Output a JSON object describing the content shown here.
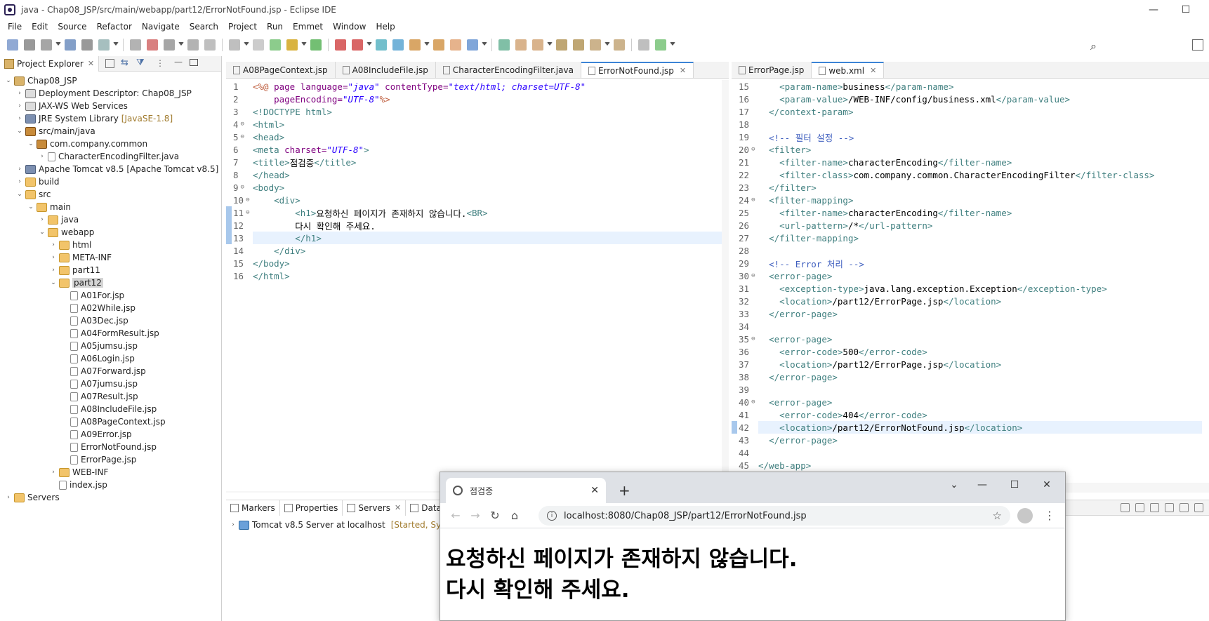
{
  "window": {
    "title": "java - Chap08_JSP/src/main/webapp/part12/ErrorNotFound.jsp - Eclipse IDE"
  },
  "menu": [
    "File",
    "Edit",
    "Source",
    "Refactor",
    "Navigate",
    "Search",
    "Project",
    "Run",
    "Emmet",
    "Window",
    "Help"
  ],
  "explorer": {
    "tab_label": "Project Explorer",
    "tree": [
      {
        "label": "Chap08_JSP",
        "depth": 0,
        "twisty": "open",
        "icon": "project"
      },
      {
        "label": "Deployment Descriptor: Chap08_JSP",
        "depth": 1,
        "twisty": "closed",
        "icon": "desc"
      },
      {
        "label": "JAX-WS Web Services",
        "depth": 1,
        "twisty": "closed",
        "icon": "desc"
      },
      {
        "label": "JRE System Library",
        "depth": 1,
        "twisty": "closed",
        "icon": "jar",
        "deco": "[JavaSE-1.8]"
      },
      {
        "label": "src/main/java",
        "depth": 1,
        "twisty": "open",
        "icon": "package"
      },
      {
        "label": "com.company.common",
        "depth": 2,
        "twisty": "open",
        "icon": "package"
      },
      {
        "label": "CharacterEncodingFilter.java",
        "depth": 3,
        "twisty": "closed",
        "icon": "file"
      },
      {
        "label": "Apache Tomcat v8.5 [Apache Tomcat v8.5]",
        "depth": 1,
        "twisty": "closed",
        "icon": "jar"
      },
      {
        "label": "build",
        "depth": 1,
        "twisty": "closed",
        "icon": "folder"
      },
      {
        "label": "src",
        "depth": 1,
        "twisty": "open",
        "icon": "folder"
      },
      {
        "label": "main",
        "depth": 2,
        "twisty": "open",
        "icon": "folder"
      },
      {
        "label": "java",
        "depth": 3,
        "twisty": "closed",
        "icon": "folder"
      },
      {
        "label": "webapp",
        "depth": 3,
        "twisty": "open",
        "icon": "folder"
      },
      {
        "label": "html",
        "depth": 4,
        "twisty": "closed",
        "icon": "folder"
      },
      {
        "label": "META-INF",
        "depth": 4,
        "twisty": "closed",
        "icon": "folder"
      },
      {
        "label": "part11",
        "depth": 4,
        "twisty": "closed",
        "icon": "folder"
      },
      {
        "label": "part12",
        "depth": 4,
        "twisty": "open",
        "icon": "folder",
        "selected": true
      },
      {
        "label": "A01For.jsp",
        "depth": 5,
        "twisty": "none",
        "icon": "file"
      },
      {
        "label": "A02While.jsp",
        "depth": 5,
        "twisty": "none",
        "icon": "file"
      },
      {
        "label": "A03Dec.jsp",
        "depth": 5,
        "twisty": "none",
        "icon": "file"
      },
      {
        "label": "A04FormResult.jsp",
        "depth": 5,
        "twisty": "none",
        "icon": "file"
      },
      {
        "label": "A05jumsu.jsp",
        "depth": 5,
        "twisty": "none",
        "icon": "file"
      },
      {
        "label": "A06Login.jsp",
        "depth": 5,
        "twisty": "none",
        "icon": "file"
      },
      {
        "label": "A07Forward.jsp",
        "depth": 5,
        "twisty": "none",
        "icon": "file"
      },
      {
        "label": "A07jumsu.jsp",
        "depth": 5,
        "twisty": "none",
        "icon": "file"
      },
      {
        "label": "A07Result.jsp",
        "depth": 5,
        "twisty": "none",
        "icon": "file"
      },
      {
        "label": "A08IncludeFile.jsp",
        "depth": 5,
        "twisty": "none",
        "icon": "file"
      },
      {
        "label": "A08PageContext.jsp",
        "depth": 5,
        "twisty": "none",
        "icon": "file"
      },
      {
        "label": "A09Error.jsp",
        "depth": 5,
        "twisty": "none",
        "icon": "file"
      },
      {
        "label": "ErrorNotFound.jsp",
        "depth": 5,
        "twisty": "none",
        "icon": "file"
      },
      {
        "label": "ErrorPage.jsp",
        "depth": 5,
        "twisty": "none",
        "icon": "file"
      },
      {
        "label": "WEB-INF",
        "depth": 4,
        "twisty": "closed",
        "icon": "folder"
      },
      {
        "label": "index.jsp",
        "depth": 4,
        "twisty": "none",
        "icon": "file"
      },
      {
        "label": "Servers",
        "depth": 0,
        "twisty": "closed",
        "icon": "folder"
      }
    ]
  },
  "editor_left": {
    "tabs": [
      {
        "label": "A08PageContext.jsp",
        "active": false
      },
      {
        "label": "A08IncludeFile.jsp",
        "active": false
      },
      {
        "label": "CharacterEncodingFilter.java",
        "active": false
      },
      {
        "label": "ErrorNotFound.jsp",
        "active": true
      }
    ],
    "lines": [
      {
        "n": "1",
        "fold": "",
        "mark": false,
        "hl": false,
        "parts": [
          [
            "jsp",
            "<%@ "
          ],
          [
            "attr",
            "page "
          ],
          [
            "attr",
            "language="
          ],
          [
            "val",
            "\"java\" "
          ],
          [
            "attr",
            "contentType="
          ],
          [
            "val",
            "\"text/html; charset=UTF-8\""
          ]
        ]
      },
      {
        "n": "2",
        "fold": "",
        "mark": false,
        "hl": false,
        "parts": [
          [
            "txt",
            "    "
          ],
          [
            "attr",
            "pageEncoding="
          ],
          [
            "val",
            "\"UTF-8\""
          ],
          [
            "jsp",
            "%>"
          ]
        ]
      },
      {
        "n": "3",
        "fold": "",
        "mark": false,
        "hl": false,
        "parts": [
          [
            "tag",
            "<!DOCTYPE html>"
          ]
        ]
      },
      {
        "n": "4",
        "fold": "⊖",
        "mark": false,
        "hl": false,
        "parts": [
          [
            "tag",
            "<html>"
          ]
        ]
      },
      {
        "n": "5",
        "fold": "⊖",
        "mark": false,
        "hl": false,
        "parts": [
          [
            "tag",
            "<head>"
          ]
        ]
      },
      {
        "n": "6",
        "fold": "",
        "mark": false,
        "hl": false,
        "parts": [
          [
            "tag",
            "<meta "
          ],
          [
            "attr",
            "charset="
          ],
          [
            "val",
            "\"UTF-8\""
          ],
          [
            "tag",
            ">"
          ]
        ]
      },
      {
        "n": "7",
        "fold": "",
        "mark": false,
        "hl": false,
        "parts": [
          [
            "tag",
            "<title>"
          ],
          [
            "txt",
            "점검중"
          ],
          [
            "tag",
            "</title>"
          ]
        ]
      },
      {
        "n": "8",
        "fold": "",
        "mark": false,
        "hl": false,
        "parts": [
          [
            "tag",
            "</head>"
          ]
        ]
      },
      {
        "n": "9",
        "fold": "⊖",
        "mark": false,
        "hl": false,
        "parts": [
          [
            "tag",
            "<body>"
          ]
        ]
      },
      {
        "n": "10",
        "fold": "⊖",
        "mark": false,
        "hl": false,
        "parts": [
          [
            "txt",
            "    "
          ],
          [
            "tag",
            "<div>"
          ]
        ]
      },
      {
        "n": "11",
        "fold": "⊖",
        "mark": true,
        "hl": false,
        "parts": [
          [
            "txt",
            "        "
          ],
          [
            "tag",
            "<h1>"
          ],
          [
            "txt",
            "요청하신 페이지가 존재하지 않습니다."
          ],
          [
            "tag",
            "<BR>"
          ]
        ]
      },
      {
        "n": "12",
        "fold": "",
        "mark": true,
        "hl": false,
        "parts": [
          [
            "txt",
            "        다시 확인해 주세요."
          ]
        ]
      },
      {
        "n": "13",
        "fold": "",
        "mark": true,
        "hl": true,
        "parts": [
          [
            "txt",
            "        "
          ],
          [
            "tag",
            "</h1>"
          ]
        ]
      },
      {
        "n": "14",
        "fold": "",
        "mark": false,
        "hl": false,
        "parts": [
          [
            "txt",
            "    "
          ],
          [
            "tag",
            "</div>"
          ]
        ]
      },
      {
        "n": "15",
        "fold": "",
        "mark": false,
        "hl": false,
        "parts": [
          [
            "tag",
            "</body>"
          ]
        ]
      },
      {
        "n": "16",
        "fold": "",
        "mark": false,
        "hl": false,
        "parts": [
          [
            "tag",
            "</html>"
          ]
        ]
      }
    ]
  },
  "editor_right": {
    "tabs": [
      {
        "label": "ErrorPage.jsp",
        "active": false
      },
      {
        "label": "web.xml",
        "active": true
      }
    ],
    "lines": [
      {
        "n": "15",
        "fold": "",
        "mark": false,
        "hl": false,
        "parts": [
          [
            "txt",
            "    "
          ],
          [
            "tag",
            "<param-name>"
          ],
          [
            "txt",
            "business"
          ],
          [
            "tag",
            "</param-name>"
          ]
        ]
      },
      {
        "n": "16",
        "fold": "",
        "mark": false,
        "hl": false,
        "parts": [
          [
            "txt",
            "    "
          ],
          [
            "tag",
            "<param-value>"
          ],
          [
            "txt",
            "/WEB-INF/config/business.xml"
          ],
          [
            "tag",
            "</param-value>"
          ]
        ]
      },
      {
        "n": "17",
        "fold": "",
        "mark": false,
        "hl": false,
        "parts": [
          [
            "txt",
            "  "
          ],
          [
            "tag",
            "</context-param>"
          ]
        ]
      },
      {
        "n": "18",
        "fold": "",
        "mark": false,
        "hl": false,
        "parts": []
      },
      {
        "n": "19",
        "fold": "",
        "mark": false,
        "hl": false,
        "parts": [
          [
            "txt",
            "  "
          ],
          [
            "com",
            "<!-- 필터 설정 -->"
          ]
        ]
      },
      {
        "n": "20",
        "fold": "⊖",
        "mark": false,
        "hl": false,
        "parts": [
          [
            "txt",
            "  "
          ],
          [
            "tag",
            "<filter>"
          ]
        ]
      },
      {
        "n": "21",
        "fold": "",
        "mark": false,
        "hl": false,
        "parts": [
          [
            "txt",
            "    "
          ],
          [
            "tag",
            "<filter-name>"
          ],
          [
            "txt",
            "characterEncoding"
          ],
          [
            "tag",
            "</filter-name>"
          ]
        ]
      },
      {
        "n": "22",
        "fold": "",
        "mark": false,
        "hl": false,
        "parts": [
          [
            "txt",
            "    "
          ],
          [
            "tag",
            "<filter-class>"
          ],
          [
            "txt",
            "com.company.common.CharacterEncodingFilter"
          ],
          [
            "tag",
            "</filter-class>"
          ]
        ]
      },
      {
        "n": "23",
        "fold": "",
        "mark": false,
        "hl": false,
        "parts": [
          [
            "txt",
            "  "
          ],
          [
            "tag",
            "</filter>"
          ]
        ]
      },
      {
        "n": "24",
        "fold": "⊖",
        "mark": false,
        "hl": false,
        "parts": [
          [
            "txt",
            "  "
          ],
          [
            "tag",
            "<filter-mapping>"
          ]
        ]
      },
      {
        "n": "25",
        "fold": "",
        "mark": false,
        "hl": false,
        "parts": [
          [
            "txt",
            "    "
          ],
          [
            "tag",
            "<filter-name>"
          ],
          [
            "txt",
            "characterEncoding"
          ],
          [
            "tag",
            "</filter-name>"
          ]
        ]
      },
      {
        "n": "26",
        "fold": "",
        "mark": false,
        "hl": false,
        "parts": [
          [
            "txt",
            "    "
          ],
          [
            "tag",
            "<url-pattern>"
          ],
          [
            "txt",
            "/*"
          ],
          [
            "tag",
            "</url-pattern>"
          ]
        ]
      },
      {
        "n": "27",
        "fold": "",
        "mark": false,
        "hl": false,
        "parts": [
          [
            "txt",
            "  "
          ],
          [
            "tag",
            "</filter-mapping>"
          ]
        ]
      },
      {
        "n": "28",
        "fold": "",
        "mark": false,
        "hl": false,
        "parts": []
      },
      {
        "n": "29",
        "fold": "",
        "mark": false,
        "hl": false,
        "parts": [
          [
            "txt",
            "  "
          ],
          [
            "com",
            "<!-- Error 처리 -->"
          ]
        ]
      },
      {
        "n": "30",
        "fold": "⊖",
        "mark": false,
        "hl": false,
        "parts": [
          [
            "txt",
            "  "
          ],
          [
            "tag",
            "<error-page>"
          ]
        ]
      },
      {
        "n": "31",
        "fold": "",
        "mark": false,
        "hl": false,
        "parts": [
          [
            "txt",
            "    "
          ],
          [
            "tag",
            "<exception-type>"
          ],
          [
            "txt",
            "java.lang.exception.Exception"
          ],
          [
            "tag",
            "</exception-type>"
          ]
        ]
      },
      {
        "n": "32",
        "fold": "",
        "mark": false,
        "hl": false,
        "parts": [
          [
            "txt",
            "    "
          ],
          [
            "tag",
            "<location>"
          ],
          [
            "txt",
            "/part12/ErrorPage.jsp"
          ],
          [
            "tag",
            "</location>"
          ]
        ]
      },
      {
        "n": "33",
        "fold": "",
        "mark": false,
        "hl": false,
        "parts": [
          [
            "txt",
            "  "
          ],
          [
            "tag",
            "</error-page>"
          ]
        ]
      },
      {
        "n": "34",
        "fold": "",
        "mark": false,
        "hl": false,
        "parts": []
      },
      {
        "n": "35",
        "fold": "⊖",
        "mark": false,
        "hl": false,
        "parts": [
          [
            "txt",
            "  "
          ],
          [
            "tag",
            "<error-page>"
          ]
        ]
      },
      {
        "n": "36",
        "fold": "",
        "mark": false,
        "hl": false,
        "parts": [
          [
            "txt",
            "    "
          ],
          [
            "tag",
            "<error-code>"
          ],
          [
            "txt",
            "500"
          ],
          [
            "tag",
            "</error-code>"
          ]
        ]
      },
      {
        "n": "37",
        "fold": "",
        "mark": false,
        "hl": false,
        "parts": [
          [
            "txt",
            "    "
          ],
          [
            "tag",
            "<location>"
          ],
          [
            "txt",
            "/part12/ErrorPage.jsp"
          ],
          [
            "tag",
            "</location>"
          ]
        ]
      },
      {
        "n": "38",
        "fold": "",
        "mark": false,
        "hl": false,
        "parts": [
          [
            "txt",
            "  "
          ],
          [
            "tag",
            "</error-page>"
          ]
        ]
      },
      {
        "n": "39",
        "fold": "",
        "mark": false,
        "hl": false,
        "parts": []
      },
      {
        "n": "40",
        "fold": "⊖",
        "mark": false,
        "hl": false,
        "parts": [
          [
            "txt",
            "  "
          ],
          [
            "tag",
            "<error-page>"
          ]
        ]
      },
      {
        "n": "41",
        "fold": "",
        "mark": false,
        "hl": false,
        "parts": [
          [
            "txt",
            "    "
          ],
          [
            "tag",
            "<error-code>"
          ],
          [
            "txt",
            "404"
          ],
          [
            "tag",
            "</error-code>"
          ]
        ]
      },
      {
        "n": "42",
        "fold": "",
        "mark": true,
        "hl": true,
        "parts": [
          [
            "txt",
            "    "
          ],
          [
            "tag",
            "<location>"
          ],
          [
            "txt",
            "/part12/ErrorNotFound.jsp"
          ],
          [
            "tag",
            "</location>"
          ]
        ]
      },
      {
        "n": "43",
        "fold": "",
        "mark": false,
        "hl": false,
        "parts": [
          [
            "txt",
            "  "
          ],
          [
            "tag",
            "</error-page>"
          ]
        ]
      },
      {
        "n": "44",
        "fold": "",
        "mark": false,
        "hl": false,
        "parts": []
      },
      {
        "n": "45",
        "fold": "",
        "mark": false,
        "hl": false,
        "parts": [
          [
            "tag",
            "</web-app>"
          ]
        ]
      }
    ]
  },
  "bottom_panel": {
    "tabs": [
      "Markers",
      "Properties",
      "Servers",
      "Data So"
    ],
    "server_label": "Tomcat v8.5 Server at localhost",
    "server_status": "[Started, Synchro"
  },
  "browser": {
    "tab_title": "점검중",
    "url": "localhost:8080/Chap08_JSP/part12/ErrorNotFound.jsp",
    "heading_line1": "요청하신 페이지가 존재하지 않습니다.",
    "heading_line2": "다시 확인해 주세요."
  },
  "colors": {
    "accent": "#3c84d6",
    "tag": "#3f7f7f",
    "attr": "#7f007f",
    "value": "#2a00ff",
    "comment": "#3f5fbf",
    "jsp": "#bf5f3f"
  }
}
